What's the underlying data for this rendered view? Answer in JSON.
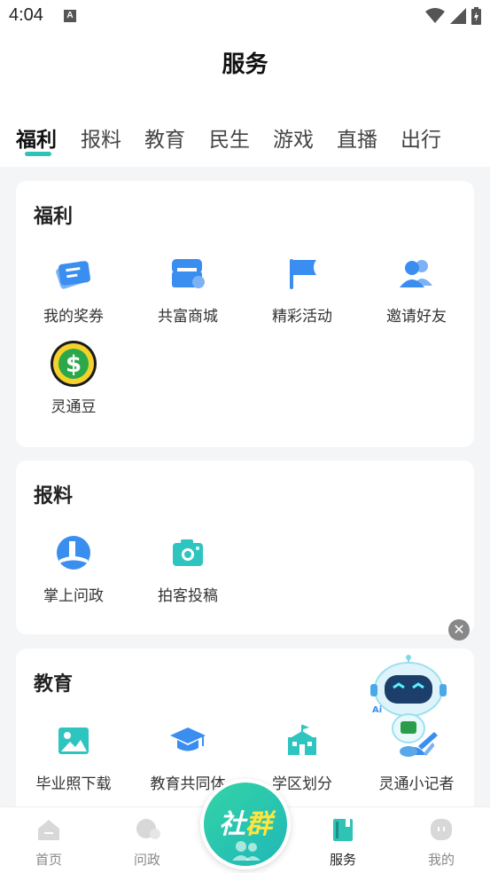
{
  "status": {
    "time": "4:04",
    "a_badge": "A"
  },
  "header": {
    "title": "服务"
  },
  "tabs": [
    {
      "label": "福利",
      "active": true
    },
    {
      "label": "报料"
    },
    {
      "label": "教育"
    },
    {
      "label": "民生"
    },
    {
      "label": "游戏"
    },
    {
      "label": "直播"
    },
    {
      "label": "出行"
    }
  ],
  "sections": {
    "welfare": {
      "title": "福利",
      "items": [
        {
          "label": "我的奖券",
          "icon": "ticket-icon"
        },
        {
          "label": "共富商城",
          "icon": "shop-icon"
        },
        {
          "label": "精彩活动",
          "icon": "flag-icon"
        },
        {
          "label": "邀请好友",
          "icon": "friends-icon"
        },
        {
          "label": "灵通豆",
          "icon": "dollar-coin-icon"
        }
      ]
    },
    "report": {
      "title": "报料",
      "items": [
        {
          "label": "掌上问政",
          "icon": "ask-gov-icon"
        },
        {
          "label": "拍客投稿",
          "icon": "camera-icon"
        }
      ]
    },
    "education": {
      "title": "教育",
      "items": [
        {
          "label": "毕业照下载",
          "icon": "image-icon"
        },
        {
          "label": "教育共同体",
          "icon": "graduation-cap-icon"
        },
        {
          "label": "学区划分",
          "icon": "school-icon"
        },
        {
          "label": "灵通小记者",
          "icon": "reporter-icon"
        }
      ]
    }
  },
  "fab": {
    "label_part1": "社",
    "label_part2": "群"
  },
  "bottom_nav": [
    {
      "label": "首页"
    },
    {
      "label": "问政"
    },
    {
      "label": "服务",
      "active": true
    },
    {
      "label": "我的"
    }
  ],
  "colors": {
    "accent": "#2fc3b5",
    "icon_blue": "#3a8ef0",
    "icon_teal": "#2ec5c0"
  }
}
